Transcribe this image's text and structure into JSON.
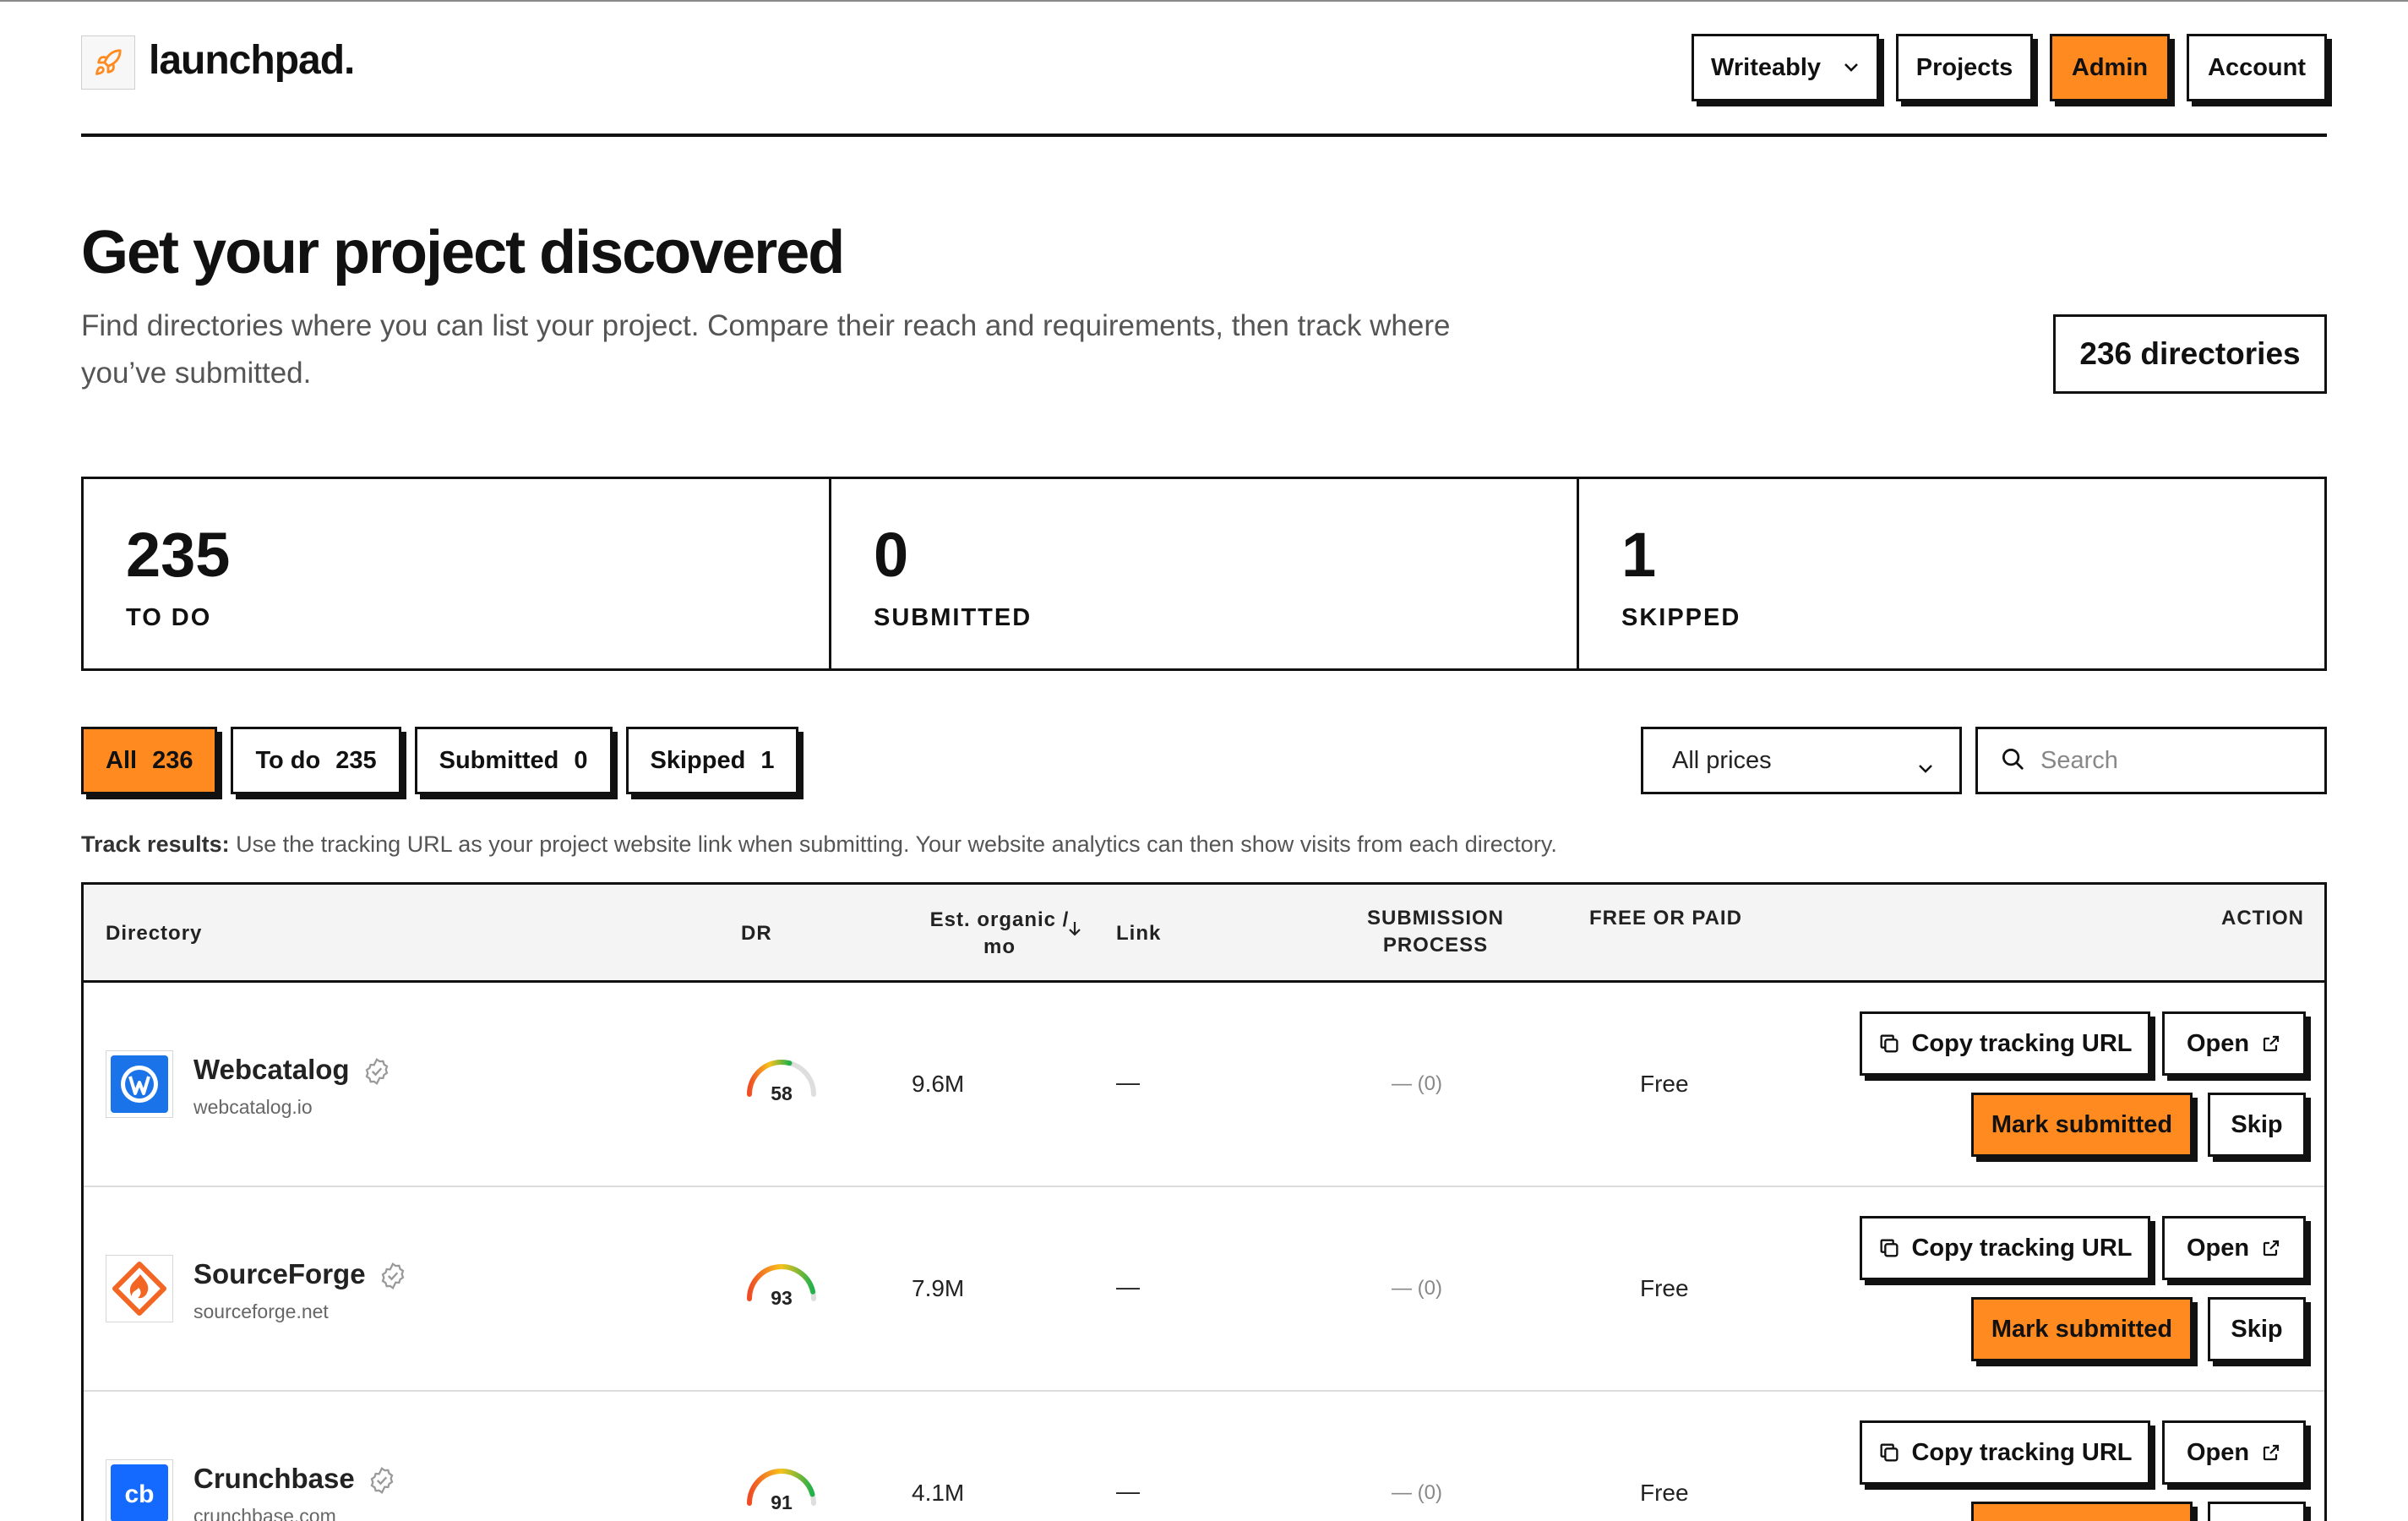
{
  "app": {
    "name": "launchpad."
  },
  "nav": {
    "project_select": "Writeably",
    "projects": "Projects",
    "admin": "Admin",
    "account": "Account"
  },
  "hero": {
    "title": "Get your project discovered",
    "subtitle": "Find directories where you can list your project. Compare their reach and requirements, then track where you’ve submitted.",
    "directory_count": "236 directories"
  },
  "stats": [
    {
      "value": "235",
      "label": "TO DO"
    },
    {
      "value": "0",
      "label": "SUBMITTED"
    },
    {
      "value": "1",
      "label": "SKIPPED"
    }
  ],
  "filters": [
    {
      "label": "All",
      "count": "236",
      "active": true
    },
    {
      "label": "To do",
      "count": "235",
      "active": false
    },
    {
      "label": "Submitted",
      "count": "0",
      "active": false
    },
    {
      "label": "Skipped",
      "count": "1",
      "active": false
    }
  ],
  "price_filter": {
    "selected": "All prices"
  },
  "search": {
    "placeholder": "Search"
  },
  "track_note": {
    "bold": "Track results:",
    "text": " Use the tracking URL as your project website link when submitting. Your website analytics can then show visits from each directory."
  },
  "table": {
    "headers": {
      "directory": "Directory",
      "dr": "DR",
      "organic_line1": "Est. organic /",
      "organic_line2": "mo",
      "link": "Link",
      "process_line1": "SUBMISSION",
      "process_line2": "PROCESS",
      "price": "FREE OR PAID",
      "action": "ACTION"
    },
    "rows": [
      {
        "name": "Webcatalog",
        "domain": "webcatalog.io",
        "dr": "58",
        "dr_value": 58,
        "traffic": "9.6M",
        "link": "—",
        "process": "— (0)",
        "price": "Free",
        "icon": "webcatalog-logo",
        "color": "#1a73e8"
      },
      {
        "name": "SourceForge",
        "domain": "sourceforge.net",
        "dr": "93",
        "dr_value": 93,
        "traffic": "7.9M",
        "link": "—",
        "process": "— (0)",
        "price": "Free",
        "icon": "sourceforge-logo",
        "color": "#f26522"
      },
      {
        "name": "Crunchbase",
        "domain": "crunchbase.com",
        "dr": "91",
        "dr_value": 91,
        "traffic": "4.1M",
        "link": "—",
        "process": "— (0)",
        "price": "Free",
        "icon": "crunchbase-logo",
        "color": "#146aff"
      }
    ],
    "actions": {
      "copy": "Copy tracking URL",
      "open": "Open",
      "mark": "Mark submitted",
      "skip": "Skip"
    }
  },
  "colors": {
    "accent": "#ff8a1f",
    "border": "#111111"
  }
}
